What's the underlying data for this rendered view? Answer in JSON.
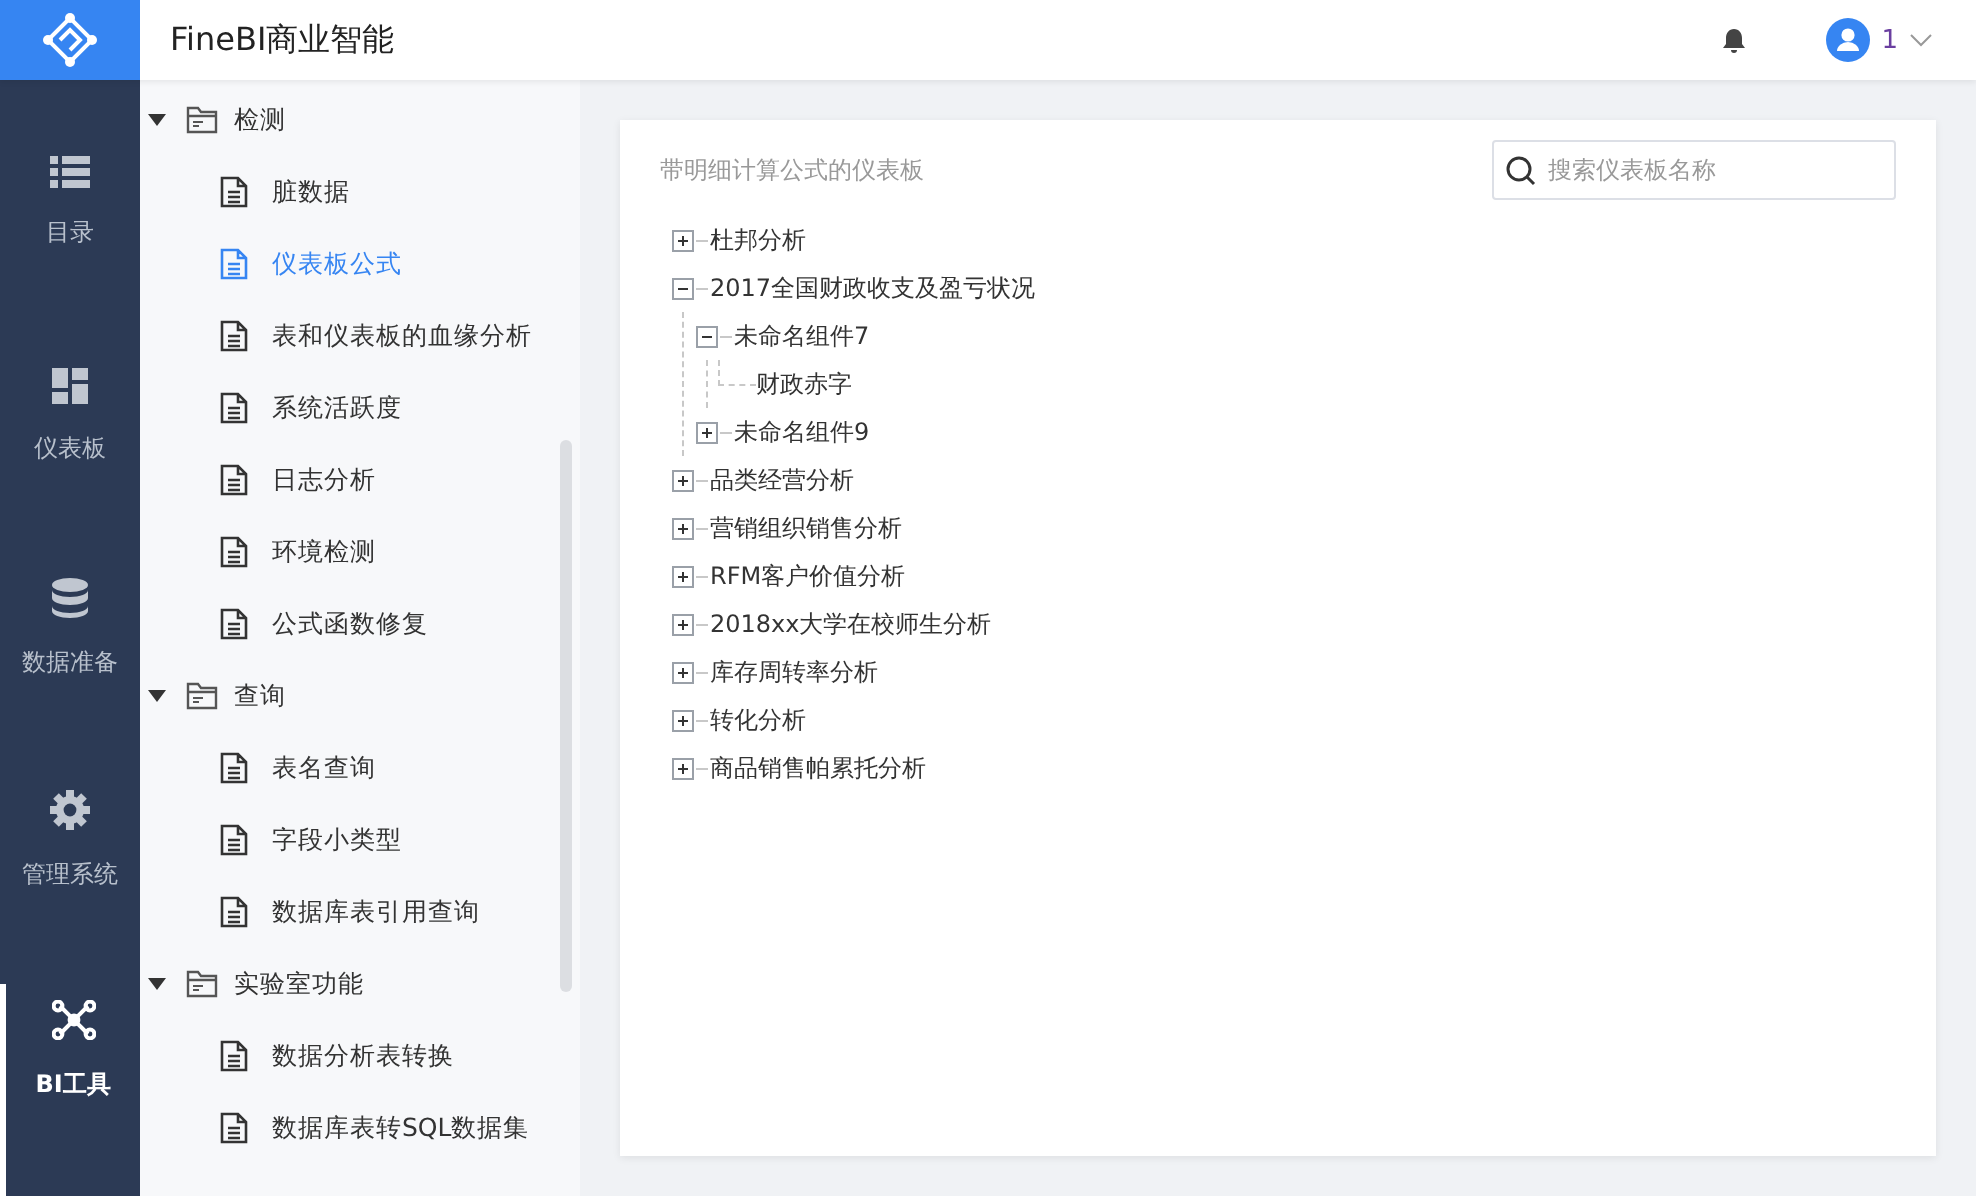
{
  "header": {
    "title": "FineBI商业智能",
    "user": "1"
  },
  "rail": [
    {
      "kind": "catalog",
      "label": "目录",
      "selected": false
    },
    {
      "kind": "dashboard",
      "label": "仪表板",
      "selected": false
    },
    {
      "kind": "data",
      "label": "数据准备",
      "selected": false
    },
    {
      "kind": "admin",
      "label": "管理系统",
      "selected": false
    },
    {
      "kind": "tools",
      "label": "BI工具",
      "selected": true
    }
  ],
  "sidebar": {
    "items": [
      {
        "kind": "folder",
        "label": "检测",
        "expanded": true,
        "children": [
          {
            "kind": "file",
            "label": "脏数据",
            "selected": false
          },
          {
            "kind": "file",
            "label": "仪表板公式",
            "selected": true
          },
          {
            "kind": "file",
            "label": "表和仪表板的血缘分析",
            "selected": false
          },
          {
            "kind": "file",
            "label": "系统活跃度",
            "selected": false
          },
          {
            "kind": "file",
            "label": "日志分析",
            "selected": false
          },
          {
            "kind": "file",
            "label": "环境检测",
            "selected": false
          },
          {
            "kind": "file",
            "label": "公式函数修复",
            "selected": false
          }
        ]
      },
      {
        "kind": "folder",
        "label": "查询",
        "expanded": true,
        "children": [
          {
            "kind": "file",
            "label": "表名查询",
            "selected": false
          },
          {
            "kind": "file",
            "label": "字段小类型",
            "selected": false
          },
          {
            "kind": "file",
            "label": "数据库表引用查询",
            "selected": false
          }
        ]
      },
      {
        "kind": "folder",
        "label": "实验室功能",
        "expanded": true,
        "children": [
          {
            "kind": "file",
            "label": "数据分析表转换",
            "selected": false
          },
          {
            "kind": "file",
            "label": "数据库表转SQL数据集",
            "selected": false
          }
        ]
      }
    ]
  },
  "card": {
    "title": "带明细计算公式的仪表板",
    "search": {
      "placeholder": "搜索仪表板名称"
    },
    "tree": [
      {
        "label": "杜邦分析",
        "expanded": false
      },
      {
        "label": "2017全国财政收支及盈亏状况",
        "expanded": true,
        "children": [
          {
            "label": "未命名组件7",
            "expanded": true,
            "children": [
              {
                "label": "财政赤字"
              }
            ]
          },
          {
            "label": "未命名组件9",
            "expanded": false
          }
        ]
      },
      {
        "label": "品类经营分析",
        "expanded": false
      },
      {
        "label": "营销组织销售分析",
        "expanded": false
      },
      {
        "label": "RFM客户价值分析",
        "expanded": false
      },
      {
        "label": "2018xx大学在校师生分析",
        "expanded": false
      },
      {
        "label": "库存周转率分析",
        "expanded": false
      },
      {
        "label": "转化分析",
        "expanded": false
      },
      {
        "label": "商品销售帕累托分析",
        "expanded": false
      }
    ]
  }
}
